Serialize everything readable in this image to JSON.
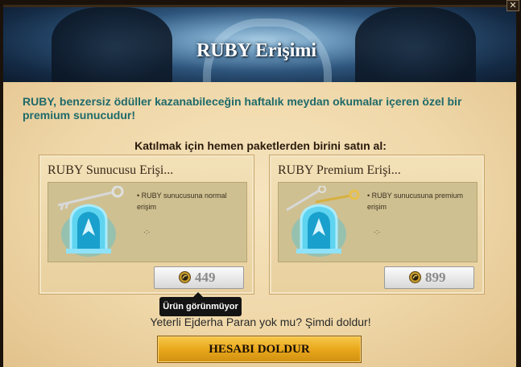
{
  "window": {
    "close_glyph": "✕"
  },
  "header": {
    "title": "RUBY Erişimi"
  },
  "intro_text": "RUBY, benzersiz ödüller kazanabileceğin haftalık meydan okumalar içeren özel bir premium sunucudur!",
  "subheading": "Katılmak için hemen paketlerden birini satın al:",
  "packages": [
    {
      "title": "RUBY Sunucusu Erişi...",
      "description": "• RUBY sunucusuna normal erişim",
      "tick": "·:·",
      "price": "449",
      "price_icon": "dragon-coin-icon",
      "key_icon": "silver-key-icon",
      "portal_icon": "portal-icon"
    },
    {
      "title": "RUBY Premium Erişi...",
      "description": "• RUBY sunucusuna premium erişim",
      "tick": "·:·",
      "price": "899",
      "price_icon": "dragon-coin-icon",
      "key_icon": "gold-and-silver-keys-icon",
      "portal_icon": "portal-icon"
    }
  ],
  "tooltip": "Ürün görünmüyor",
  "refill_prompt": "Yeterli Ejderha Paran yok mu? Şimdi doldur!",
  "refill_button": "HESABI DOLDUR",
  "colors": {
    "intro_text": "#1f6a6a",
    "refill_button": "#e9a81c",
    "price_text": "#8a8a8a"
  }
}
